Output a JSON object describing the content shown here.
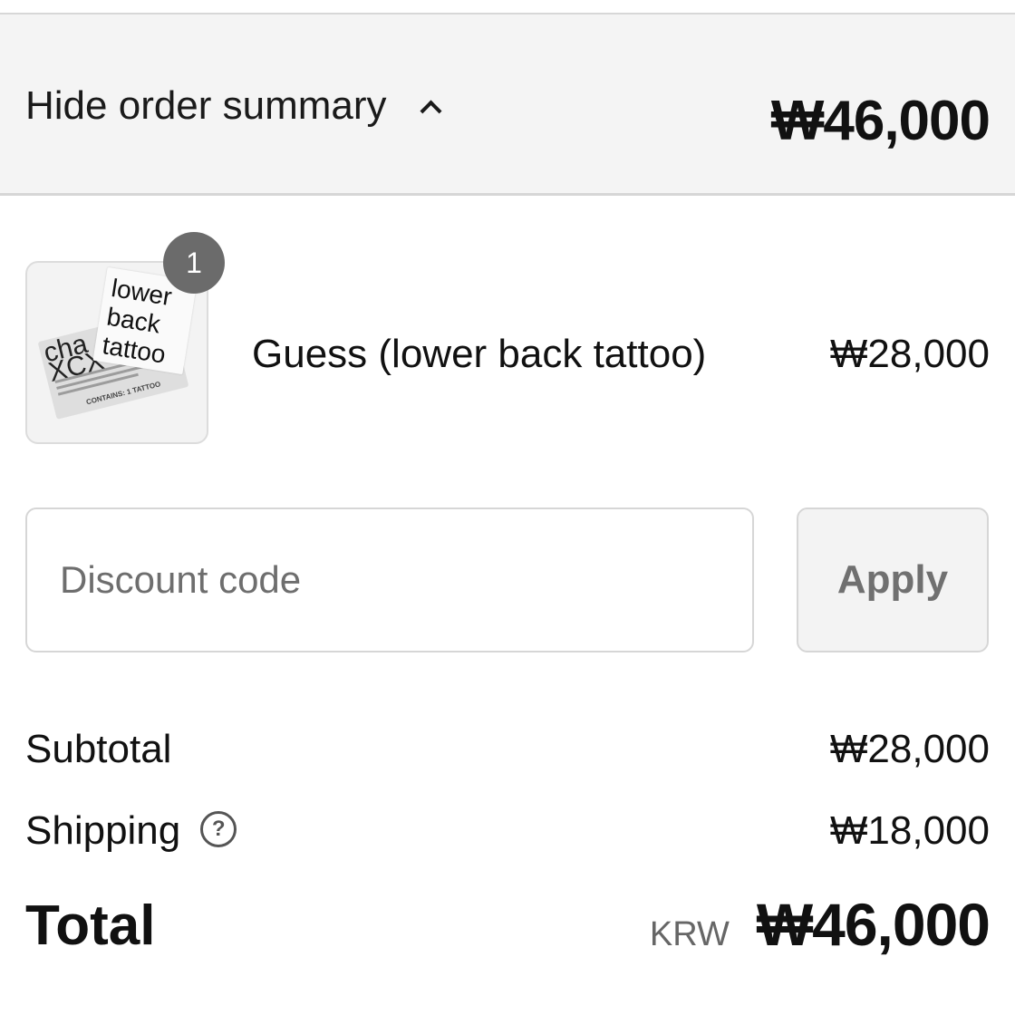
{
  "summary_bar": {
    "toggle_label": "Hide order summary",
    "toggle_icon": "chevron-up-icon",
    "total": "₩46,000"
  },
  "product": {
    "quantity": "1",
    "name": "Guess (lower back tattoo)",
    "price": "₩28,000",
    "thumbnail": {
      "card_front_text": [
        "lower",
        "back",
        "tattoo"
      ],
      "card_back_text": [
        "cha",
        "XCX"
      ],
      "contains_text": "CONTAINS: 1 TATTOO"
    }
  },
  "discount": {
    "placeholder": "Discount code",
    "value": "",
    "apply_label": "Apply"
  },
  "totals": {
    "subtotal_label": "Subtotal",
    "subtotal_value": "₩28,000",
    "shipping_label": "Shipping",
    "shipping_help_icon": "question-circle-icon",
    "shipping_value": "₩18,000",
    "total_label": "Total",
    "currency_code": "KRW",
    "total_value": "₩46,000"
  }
}
